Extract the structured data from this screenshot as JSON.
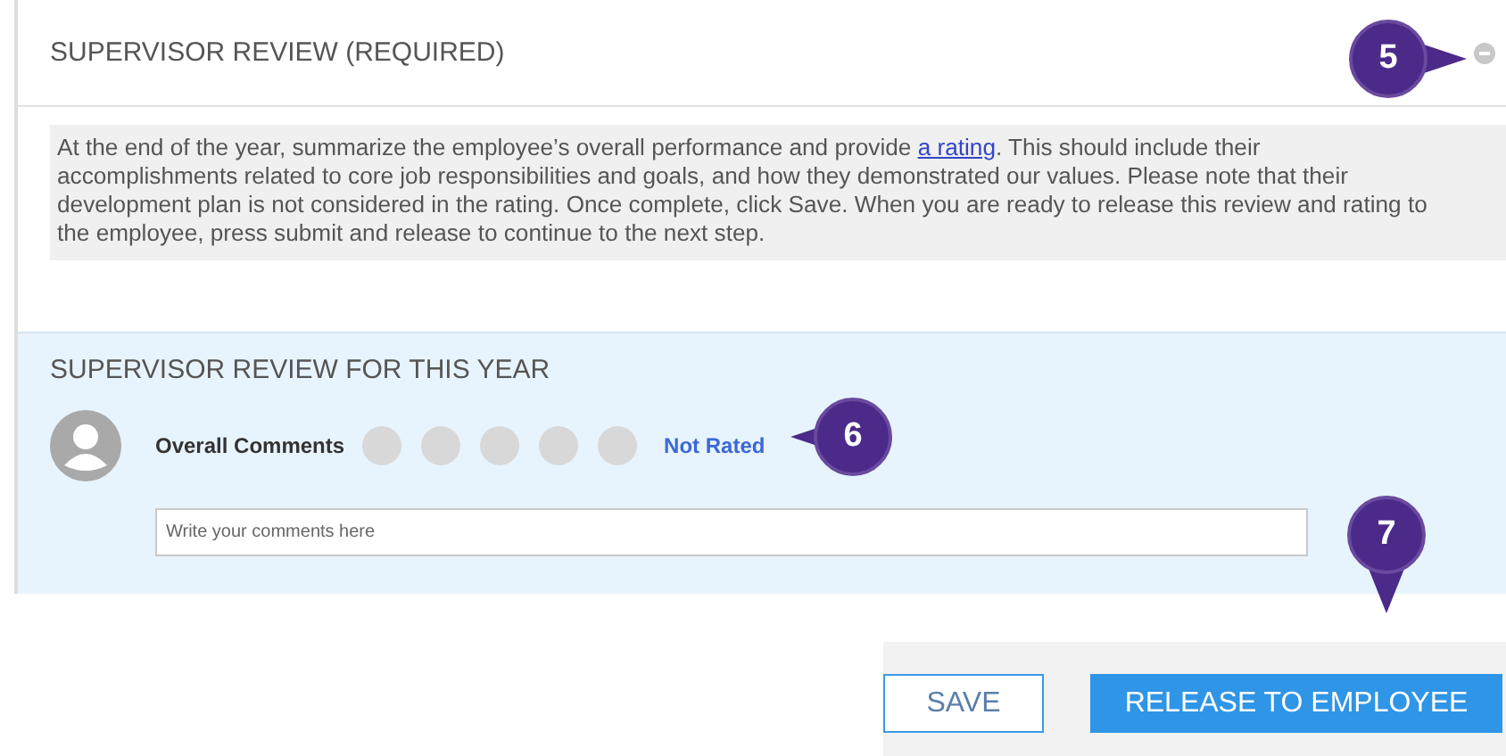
{
  "required_section": {
    "title": "SUPERVISOR REVIEW (REQUIRED)",
    "collapsed": false,
    "instructions": "At the end of the year, summarize the employee’s overall performance and provide ",
    "instructions_link": "a rating",
    "instructions_rest": ". This should include their accomplishments related to core job responsibilities and goals, and how they demonstrated our values. Please note that their development plan is not considered in the rating. Once complete, click Save. When you are ready to release this review and rating to the employee, press submit and release to continue to the next step."
  },
  "review_section": {
    "title": "SUPERVISOR REVIEW FOR THIS YEAR",
    "label": "Overall Comments",
    "stars": 0,
    "rating_text": "Not Rated",
    "comment": {
      "placeholder": "Write your comments here"
    }
  },
  "buttons": [
    {
      "label": "SAVE",
      "kind": "secondary"
    },
    {
      "label": "RELEASE TO EMPLOYEE",
      "kind": "primary"
    }
  ],
  "callouts": [
    {
      "label": "5",
      "kind": "right"
    },
    {
      "label": "6",
      "kind": "left"
    },
    {
      "label": "7",
      "kind": "down"
    }
  ]
}
